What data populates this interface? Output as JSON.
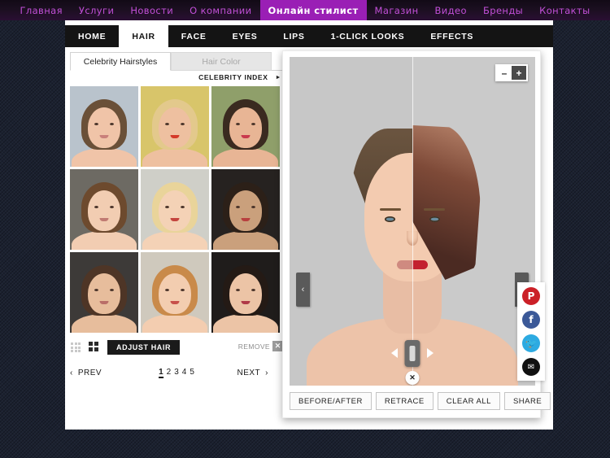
{
  "topnav": {
    "items": [
      {
        "label": "Главная",
        "active": false
      },
      {
        "label": "Услуги",
        "active": false
      },
      {
        "label": "Новости",
        "active": false
      },
      {
        "label": "О компании",
        "active": false
      },
      {
        "label": "Онлайн стилист",
        "active": true
      },
      {
        "label": "Магазин",
        "active": false
      },
      {
        "label": "Видео",
        "active": false
      },
      {
        "label": "Бренды",
        "active": false
      },
      {
        "label": "Контакты",
        "active": false
      }
    ],
    "accent_color": "#9a1fb5",
    "link_color": "#c24fd8"
  },
  "tabstrip": {
    "tabs": [
      {
        "label": "HOME",
        "active": false
      },
      {
        "label": "HAIR",
        "active": true
      },
      {
        "label": "FACE",
        "active": false
      },
      {
        "label": "EYES",
        "active": false
      },
      {
        "label": "LIPS",
        "active": false
      },
      {
        "label": "1-CLICK LOOKS",
        "active": false
      },
      {
        "label": "EFFECTS",
        "active": false
      }
    ]
  },
  "left_panel": {
    "subtabs": [
      {
        "label": "Celebrity Hairstyles",
        "active": true
      },
      {
        "label": "Hair Color",
        "active": false
      }
    ],
    "celebrity_index_label": "CELEBRITY INDEX",
    "celebrity_index_arrow": "►",
    "thumbnails": [
      {
        "name": "celebrity-thumb-1",
        "selected": true,
        "skin": "#f0c4a8",
        "hair": "#6a5038",
        "bg": "#b9c3cc",
        "lip": "#c9807b",
        "style": "short-pixie-brunette"
      },
      {
        "name": "celebrity-thumb-2",
        "selected": false,
        "skin": "#eec0a0",
        "hair": "#e3c98c",
        "bg": "#d8c56a",
        "lip": "#d43a2a",
        "style": "blonde-headband-curls"
      },
      {
        "name": "celebrity-thumb-3",
        "selected": false,
        "skin": "#e8b595",
        "hair": "#3a2a20",
        "bg": "#8f9f6a",
        "lip": "#c93a4e",
        "style": "dark-bob-bangs"
      },
      {
        "name": "celebrity-thumb-4",
        "selected": false,
        "skin": "#f2cdb2",
        "hair": "#6d4a2e",
        "bg": "#6d6a63",
        "lip": "#c07a72",
        "style": "long-wavy-brunette"
      },
      {
        "name": "celebrity-thumb-5",
        "selected": false,
        "skin": "#f4d2b6",
        "hair": "#e9d49a",
        "bg": "#cfcfc8",
        "lip": "#c4453e",
        "style": "long-straight-blonde"
      },
      {
        "name": "celebrity-thumb-6",
        "selected": false,
        "skin": "#caa07c",
        "hair": "#2c2018",
        "bg": "#262220",
        "lip": "#b8403f",
        "style": "dark-long-layers"
      },
      {
        "name": "celebrity-thumb-7",
        "selected": false,
        "skin": "#e7bd9c",
        "hair": "#4e3526",
        "bg": "#3d3a38",
        "lip": "#b96e68",
        "style": "brunette-center-part"
      },
      {
        "name": "celebrity-thumb-8",
        "selected": false,
        "skin": "#f3cdb0",
        "hair": "#c98a4a",
        "bg": "#cfc9bd",
        "lip": "#c7504a",
        "style": "auburn-long-waves"
      },
      {
        "name": "celebrity-thumb-9",
        "selected": false,
        "skin": "#ecc4a6",
        "hair": "#241a15",
        "bg": "#1f1c1b",
        "lip": "#b03a48",
        "style": "black-long-curls"
      }
    ],
    "view_toggle": {
      "small_grid_label": "small-grid-view",
      "large_grid_label": "large-grid-view",
      "active": "large"
    },
    "adjust_hair_label": "ADJUST HAIR",
    "remove_label": "REMOVE",
    "remove_icon": "✕",
    "pagination": {
      "prev_label": "PREV",
      "prev_icon": "‹",
      "next_label": "NEXT",
      "next_icon": "›",
      "pages": [
        "1",
        "2",
        "3",
        "4",
        "5"
      ],
      "current": "1"
    }
  },
  "right_panel": {
    "zoom": {
      "out_label": "–",
      "in_label": "+"
    },
    "nav_prev_icon": "‹",
    "nav_next_icon": "›",
    "slider": {
      "left_arrow": "◀",
      "right_arrow": "▶",
      "close_label": "✕"
    },
    "social": [
      {
        "name": "pinterest-icon",
        "glyph": "P",
        "color": "#cb2027"
      },
      {
        "name": "facebook-icon",
        "glyph": "f",
        "color": "#3b5998"
      },
      {
        "name": "twitter-icon",
        "glyph": "🐦",
        "color": "#2daae1"
      },
      {
        "name": "email-icon",
        "glyph": "✉",
        "color": "#111111"
      }
    ],
    "actions": [
      {
        "label": "BEFORE/AFTER"
      },
      {
        "label": "RETRACE"
      },
      {
        "label": "CLEAR ALL"
      },
      {
        "label": "SHARE"
      }
    ]
  }
}
